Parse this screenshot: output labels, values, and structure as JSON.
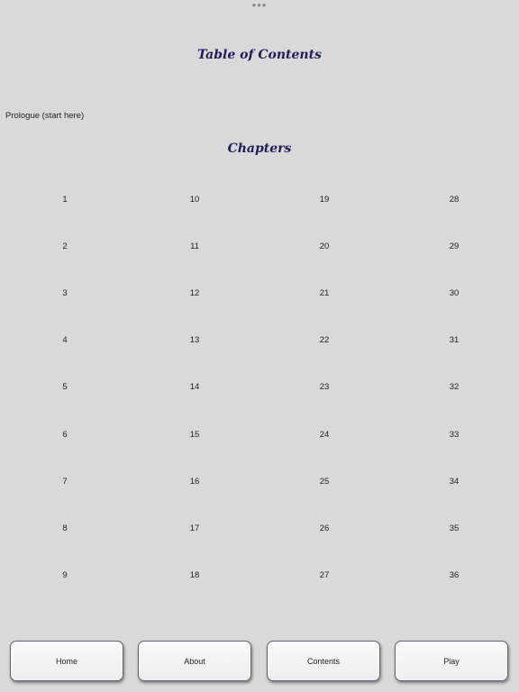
{
  "top_indicator": {
    "icon": "more-dots-icon",
    "glyph": "•••"
  },
  "title": "Table of Contents",
  "prologue_link": "Prologue (start here)",
  "chapters_heading": "Chapters",
  "chapters": [
    [
      "1",
      "10",
      "19",
      "28"
    ],
    [
      "2",
      "11",
      "20",
      "29"
    ],
    [
      "3",
      "12",
      "21",
      "30"
    ],
    [
      "4",
      "13",
      "22",
      "31"
    ],
    [
      "5",
      "14",
      "23",
      "32"
    ],
    [
      "6",
      "15",
      "24",
      "33"
    ],
    [
      "7",
      "16",
      "25",
      "34"
    ],
    [
      "8",
      "17",
      "26",
      "35"
    ],
    [
      "9",
      "18",
      "27",
      "36"
    ]
  ],
  "nav": {
    "home": "Home",
    "about": "About",
    "contents": "Contents",
    "play": "Play"
  },
  "colors": {
    "background": "#d9d9d9",
    "heading": "#1e1e5a",
    "button_border": "#5d6670"
  }
}
